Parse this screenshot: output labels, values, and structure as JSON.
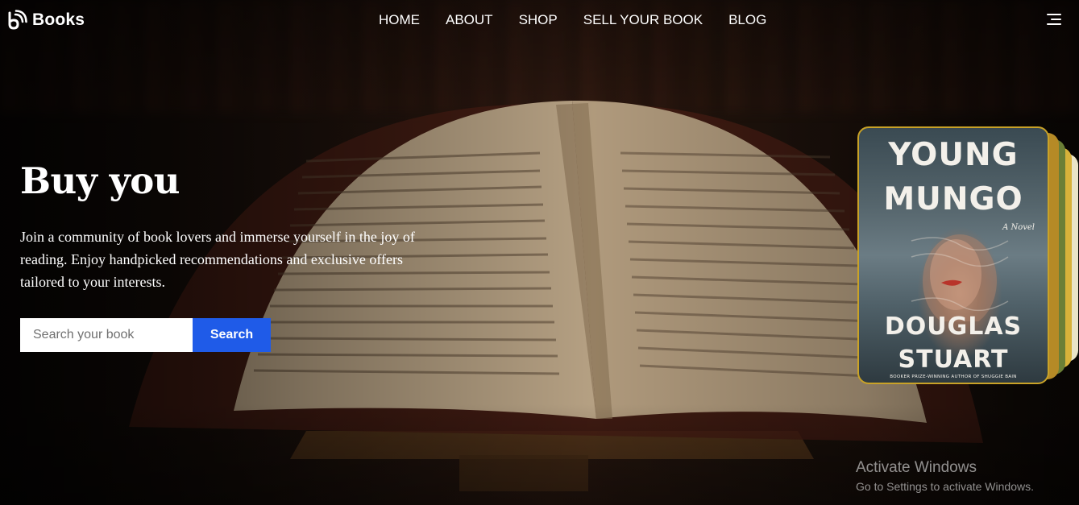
{
  "brand": {
    "name": "Books",
    "logo_icon": "brand-logo-icon"
  },
  "nav": {
    "items": [
      {
        "label": "HOME"
      },
      {
        "label": "ABOUT"
      },
      {
        "label": "SHOP"
      },
      {
        "label": "SELL YOUR BOOK"
      },
      {
        "label": "BLOG"
      }
    ],
    "menu_icon": "hamburger-menu-icon"
  },
  "hero": {
    "title": "Buy you",
    "description": "Join a community of book lovers and immerse yourself in the joy of reading. Enjoy handpicked recommendations and exclusive offers tailored to your interests.",
    "search": {
      "placeholder": "Search your book",
      "value": "",
      "button_label": "Search"
    }
  },
  "featured_book": {
    "title": "YOUNG MUNGO",
    "subtitle": "A Novel",
    "author": "DOUGLAS STUART",
    "tagline": "BOOKER PRIZE-WINNING AUTHOR OF SHUGGIE BAIN"
  },
  "watermark": {
    "title": "Activate Windows",
    "subtitle": "Go to Settings to activate Windows."
  },
  "colors": {
    "accent": "#1f5be8",
    "text": "#ffffff",
    "cover_border": "#c9a227"
  }
}
